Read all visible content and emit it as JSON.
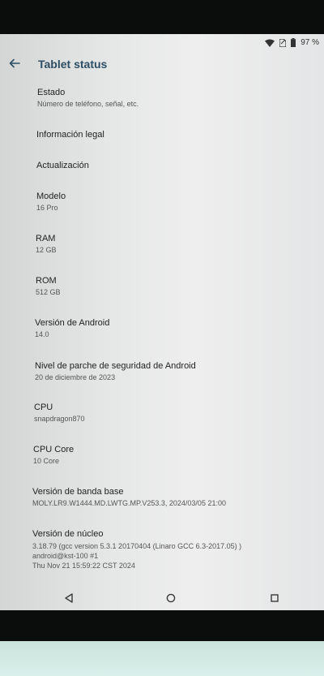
{
  "statusbar": {
    "battery_percent": "97 %",
    "icons": [
      "wifi-icon",
      "sim-icon",
      "battery-icon"
    ]
  },
  "header": {
    "title": "Tablet status",
    "back_icon": "arrow-left-icon"
  },
  "items": [
    {
      "title": "Estado",
      "subtitle": "Número de teléfono, señal, etc."
    },
    {
      "title": "Información legal",
      "subtitle": ""
    },
    {
      "title": "Actualización",
      "subtitle": ""
    },
    {
      "title": "Modelo",
      "subtitle": "16 Pro"
    },
    {
      "title": "RAM",
      "subtitle": "12 GB"
    },
    {
      "title": "ROM",
      "subtitle": "512 GB"
    },
    {
      "title": "Versión de Android",
      "subtitle": "14.0"
    },
    {
      "title": "Nivel de parche de seguridad de Android",
      "subtitle": "20 de diciembre de 2023"
    },
    {
      "title": "CPU",
      "subtitle": "snapdragon870"
    },
    {
      "title": "CPU Core",
      "subtitle": "10 Core"
    },
    {
      "title": "Versión de banda base",
      "subtitle": "MOLY.LR9.W1444.MD.LWTG.MP.V253.3, 2024/03/05 21:00"
    },
    {
      "title": "Versión de núcleo",
      "lines": [
        "3.18.79 (gcc version 5.3.1 20170404 (Linaro GCC 6.3-2017.05) )",
        "android@kst-100 #1",
        "Thu Nov 21 15:59:22 CST 2024"
      ]
    }
  ],
  "navbar": {
    "back": "triangle-back-icon",
    "home": "circle-home-icon",
    "recents": "square-recents-icon"
  },
  "colors": {
    "title": "#2d4e63",
    "text": "#1f1f1f",
    "subtext": "#555555",
    "bezel": "#0b0d0d"
  }
}
